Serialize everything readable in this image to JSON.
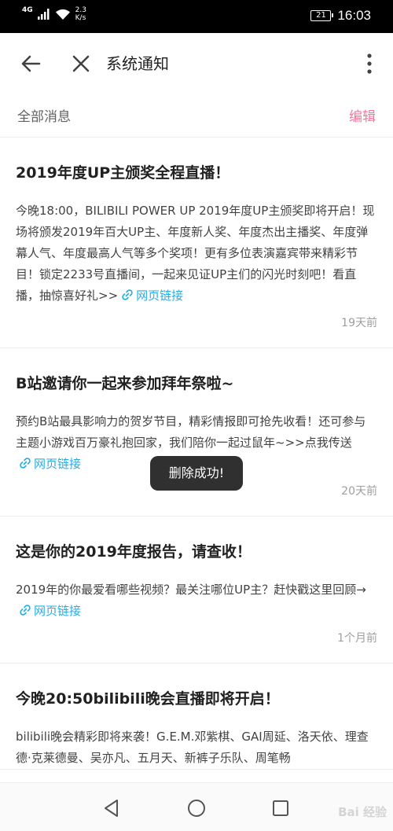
{
  "status_bar": {
    "network": "4G",
    "speed_value": "2.3",
    "speed_unit": "K/s",
    "battery": "21",
    "time": "16:03"
  },
  "header": {
    "title": "系统通知",
    "icons": [
      "arrow-left-icon",
      "close-icon",
      "more-vertical-icon"
    ]
  },
  "filter": {
    "label": "全部消息",
    "edit_label": "编辑"
  },
  "colors": {
    "accent": "#fb7299",
    "link": "#23ade5"
  },
  "messages": [
    {
      "title": "2019年度UP主颁奖全程直播！",
      "body": "今晚18:00，BILIBILI POWER UP 2019年度UP主颁奖即将开启！现场将颁发2019年百大UP主、年度新人奖、年度杰出主播奖、年度弹幕人气、年度最高人气等多个奖项！更有多位表演嘉宾带来精彩节目！锁定2233号直播间，一起来见证UP主们的闪光时刻吧！看直播，抽惊喜好礼>>",
      "link": "网页链接",
      "time": "19天前"
    },
    {
      "title": "B站邀请你一起来参加拜年祭啦~",
      "body": "预约B站最具影响力的贺岁节目，精彩情报即可抢先收看！还可参与主题小游戏百万豪礼抱回家，我们陪你一起过鼠年~>>点我传送",
      "link": "网页链接",
      "time": "20天前"
    },
    {
      "title": "这是你的2019年度报告，请查收！",
      "body": "2019年的你最爱看哪些视频？最关注哪位UP主？赶快戳这里回顾→",
      "link": "网页链接",
      "time": "1个月前"
    },
    {
      "title": "今晚20:50bilibili晚会直播即将开启！",
      "body": "bilibili晚会精彩即将来袭！G.E.M.邓紫棋、GAI周延、洛天依、理查德·克莱德曼、吴亦凡、五月天、新裤子乐队、周笔畅",
      "link": "",
      "time": ""
    }
  ],
  "toast": {
    "text": "删除成功!"
  },
  "watermark": "Bai 经验"
}
